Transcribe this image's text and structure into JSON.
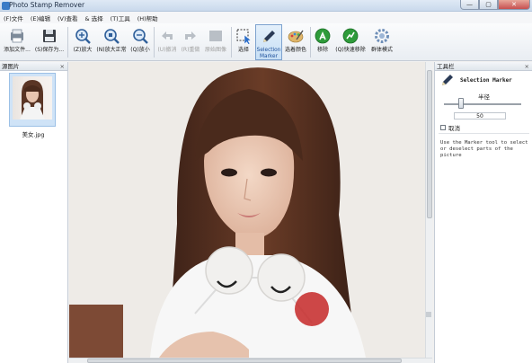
{
  "window": {
    "title": "Photo Stamp Remover",
    "buttons": [
      "—",
      "▢",
      "✕"
    ]
  },
  "menu": [
    "(F)文件",
    "(E)编辑",
    "(V)查看",
    "& 选择",
    "(T)工具",
    "(H)帮助"
  ],
  "toolbar": {
    "buttons": [
      {
        "label": "添加文件...",
        "icon": "add-file-icon",
        "disabled": false
      },
      {
        "label": "(S)保存为...",
        "icon": "save-icon",
        "disabled": false
      },
      {
        "label": "(Z)放大",
        "icon": "zoom-in-icon",
        "disabled": false
      },
      {
        "label": "(N)放大正常",
        "icon": "zoom-normal-icon",
        "disabled": false
      },
      {
        "label": "(Q)放小",
        "icon": "zoom-out-icon",
        "disabled": false
      },
      {
        "label": "(U)撤消",
        "icon": "undo-icon",
        "disabled": true
      },
      {
        "label": "(R)重做",
        "icon": "redo-icon",
        "disabled": true
      },
      {
        "label": "原始图像",
        "icon": "original-image-icon",
        "disabled": true
      },
      {
        "label": "选择",
        "icon": "select-icon",
        "disabled": false
      },
      {
        "label": "Selection Marker",
        "icon": "selection-marker-icon",
        "disabled": false,
        "active": true
      },
      {
        "label": "选着颜色",
        "icon": "color-palette-icon",
        "disabled": false
      },
      {
        "label": "移除",
        "icon": "remove-icon",
        "disabled": false
      },
      {
        "label": "(Q)快速移除",
        "icon": "quick-remove-icon",
        "disabled": false
      },
      {
        "label": "群体模式",
        "icon": "batch-mode-icon",
        "disabled": false
      }
    ]
  },
  "left_panel": {
    "title": "源图片",
    "close": "×",
    "files": [
      {
        "name": "美女.jpg"
      }
    ]
  },
  "right_panel": {
    "title": "工具栏",
    "close": "×",
    "tool_name": "Selection Marker",
    "radius_label": "半径",
    "radius_value": "50",
    "radius_fraction": 0.2,
    "cancel_label": "取消",
    "help": "Use the Marker tool to select or deselect parts of the picture"
  },
  "colors": {
    "marker": "#c62828",
    "accent": "#3a7cc7"
  }
}
